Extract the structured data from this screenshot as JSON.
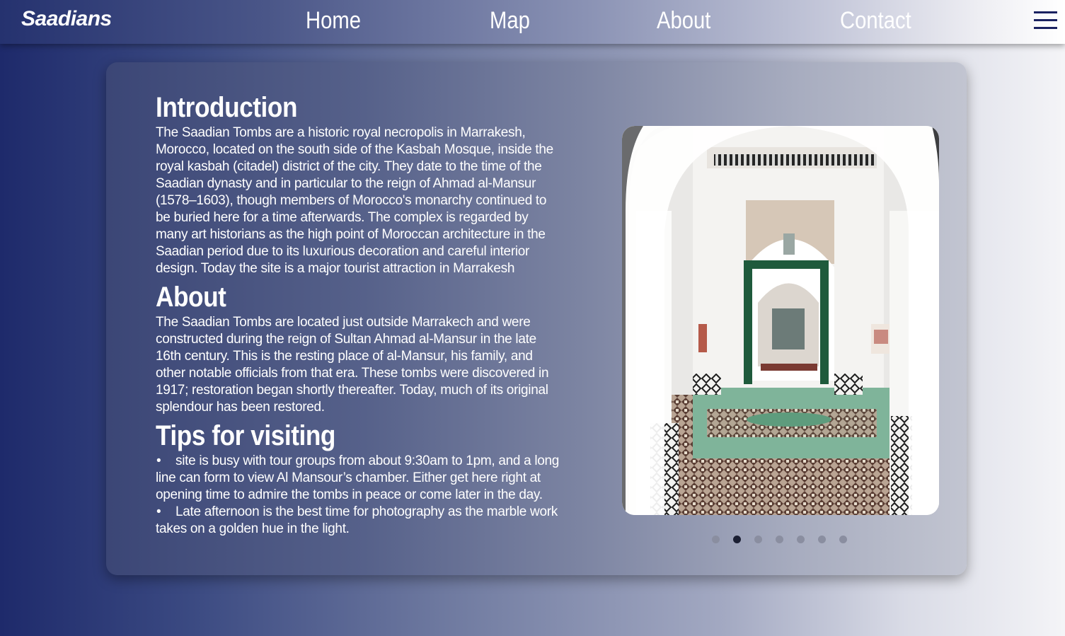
{
  "nav": {
    "brand": "Saadians",
    "links": [
      "Home",
      "Map",
      "About",
      "Contact"
    ],
    "menu_icon": "hamburger-icon"
  },
  "sections": {
    "introduction": {
      "heading": "Introduction",
      "body": "The Saadian Tombs are a historic royal necropolis in Marrakesh, Morocco, located on the south side of the Kasbah Mosque, inside the royal kasbah (citadel) district of the city. They date to the time of the Saadian dynasty and in particular to the reign of Ahmad al-Mansur (1578–1603), though members of Morocco's monarchy continued to be buried here for a time afterwards. The complex is regarded by many art historians as the high point of Moroccan architecture in the Saadian period due to its luxurious decoration and careful interior design. Today the site is a major tourist attraction in Marrakesh"
    },
    "about": {
      "heading": "About",
      "body": "The Saadian Tombs are located just outside Marrakech and were constructed during the reign of Sultan Ahmad al-Mansur in the late 16th century. This is the resting place of al-Mansur, his family, and other notable officials from that era. These tombs were discovered in 1917; restoration began shortly thereafter. Today, much of its original splendour has been restored."
    },
    "tips": {
      "heading": "Tips for visiting",
      "items": [
        "site is busy with tour groups from about 9:30am to 1pm, and a long line can form to view Al Mansour’s chamber. Either get here right at opening time to admire the tombs in peace or come later in the day.",
        "Late afternoon is the best time for photography as the marble work takes on a golden hue in the light."
      ]
    }
  },
  "carousel": {
    "slide_count": 7,
    "active_index": 1
  },
  "colors": {
    "hamburger": "#1a2160",
    "dot_active": "#1b1f33",
    "dot_inactive": "#8a8ea0",
    "door_green": "#1f5a3c",
    "pool_green": "#7fb49a"
  }
}
